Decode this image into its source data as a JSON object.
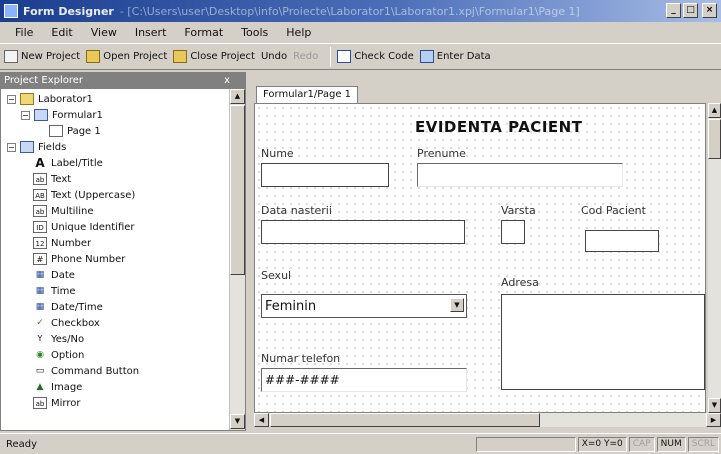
{
  "window": {
    "title": "Form Designer",
    "title_path": "- [C:\\Users\\user\\Desktop\\info\\Proiecte\\Laborator1\\Laborator1.xpj\\Formular1\\Page 1]"
  },
  "menu": [
    "File",
    "Edit",
    "View",
    "Insert",
    "Format",
    "Tools",
    "Help"
  ],
  "toolbar": {
    "new_project": "New Project",
    "open_project": "Open Project",
    "close_project": "Close Project",
    "undo": "Undo",
    "redo": "Redo",
    "check_code": "Check Code",
    "enter_data": "Enter Data"
  },
  "explorer": {
    "title": "Project Explorer",
    "close_glyph": "x",
    "items": [
      {
        "label": "Laborator1",
        "icon": "folder-icon"
      },
      {
        "label": "Formular1",
        "icon": "form-icon"
      },
      {
        "label": "Page 1",
        "icon": "page-icon"
      },
      {
        "label": "Fields",
        "icon": "fields-icon"
      },
      {
        "label": "Label/Title",
        "icon": "label-icon",
        "glyph": "A"
      },
      {
        "label": "Text",
        "icon": "text-icon",
        "glyph": "ab"
      },
      {
        "label": "Text (Uppercase)",
        "icon": "uppercase-icon",
        "glyph": "AB"
      },
      {
        "label": "Multiline",
        "icon": "multiline-icon",
        "glyph": "ab"
      },
      {
        "label": "Unique Identifier",
        "icon": "guid-icon",
        "glyph": "ID"
      },
      {
        "label": "Number",
        "icon": "number-icon",
        "glyph": "12"
      },
      {
        "label": "Phone Number",
        "icon": "phone-icon",
        "glyph": "#"
      },
      {
        "label": "Date",
        "icon": "date-icon",
        "glyph": "▦"
      },
      {
        "label": "Time",
        "icon": "time-icon",
        "glyph": "▦"
      },
      {
        "label": "Date/Time",
        "icon": "datetime-icon",
        "glyph": "▦"
      },
      {
        "label": "Checkbox",
        "icon": "checkbox-icon",
        "glyph": "✓"
      },
      {
        "label": "Yes/No",
        "icon": "yesno-icon",
        "glyph": "Y"
      },
      {
        "label": "Option",
        "icon": "option-icon",
        "glyph": "◉"
      },
      {
        "label": "Command Button",
        "icon": "command-button-icon",
        "glyph": "▭"
      },
      {
        "label": "Image",
        "icon": "image-icon",
        "glyph": "▲"
      },
      {
        "label": "Mirror",
        "icon": "mirror-icon",
        "glyph": "ab"
      }
    ]
  },
  "designer": {
    "tab": "Formular1/Page 1",
    "form": {
      "title": "EVIDENTA PACIENT",
      "nume": "Nume",
      "prenume": "Prenume",
      "data_nasterii": "Data nasterii",
      "varsta": "Varsta",
      "cod_pacient": "Cod Pacient",
      "sexul": "Sexul",
      "sexul_value": "Feminin",
      "adresa": "Adresa",
      "numar_telefon": "Numar telefon",
      "numar_telefon_value": "###-####"
    }
  },
  "status": {
    "text": "Ready",
    "cells": [
      "X=0 Y=0",
      "CAP",
      "NUM",
      "SCRL"
    ]
  }
}
